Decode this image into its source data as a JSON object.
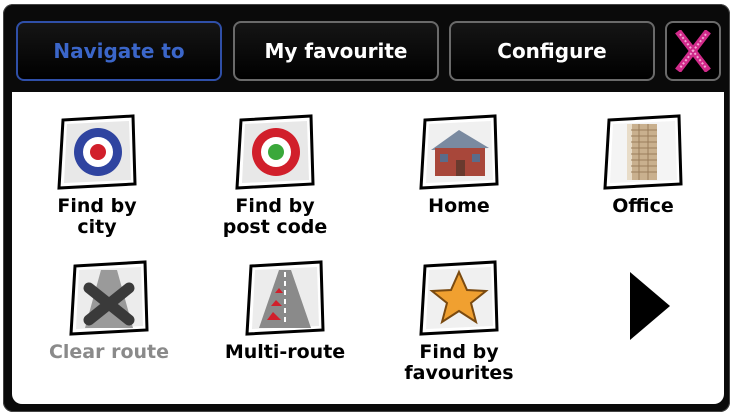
{
  "tabs": {
    "navigate": "Navigate to",
    "favourite": "My favourite",
    "configure": "Configure",
    "close_icon": "close-icon"
  },
  "items": [
    {
      "label": "Find by\ncity",
      "icon": "city-target-icon",
      "enabled": true
    },
    {
      "label": "Find by\npost code",
      "icon": "postcode-target-icon",
      "enabled": true
    },
    {
      "label": "Home",
      "icon": "house-icon",
      "enabled": true
    },
    {
      "label": "Office",
      "icon": "office-building-icon",
      "enabled": true
    },
    {
      "label": "Clear route",
      "icon": "clear-route-icon",
      "enabled": false
    },
    {
      "label": "Multi-route",
      "icon": "multi-route-icon",
      "enabled": true
    },
    {
      "label": "Find by\nfavourites",
      "icon": "star-icon",
      "enabled": true
    }
  ],
  "next_icon": "next-arrow-icon",
  "colors": {
    "active_tab": "#3b66c9",
    "disabled_text": "#8a8a8a",
    "close_x": "#d12a8a"
  }
}
